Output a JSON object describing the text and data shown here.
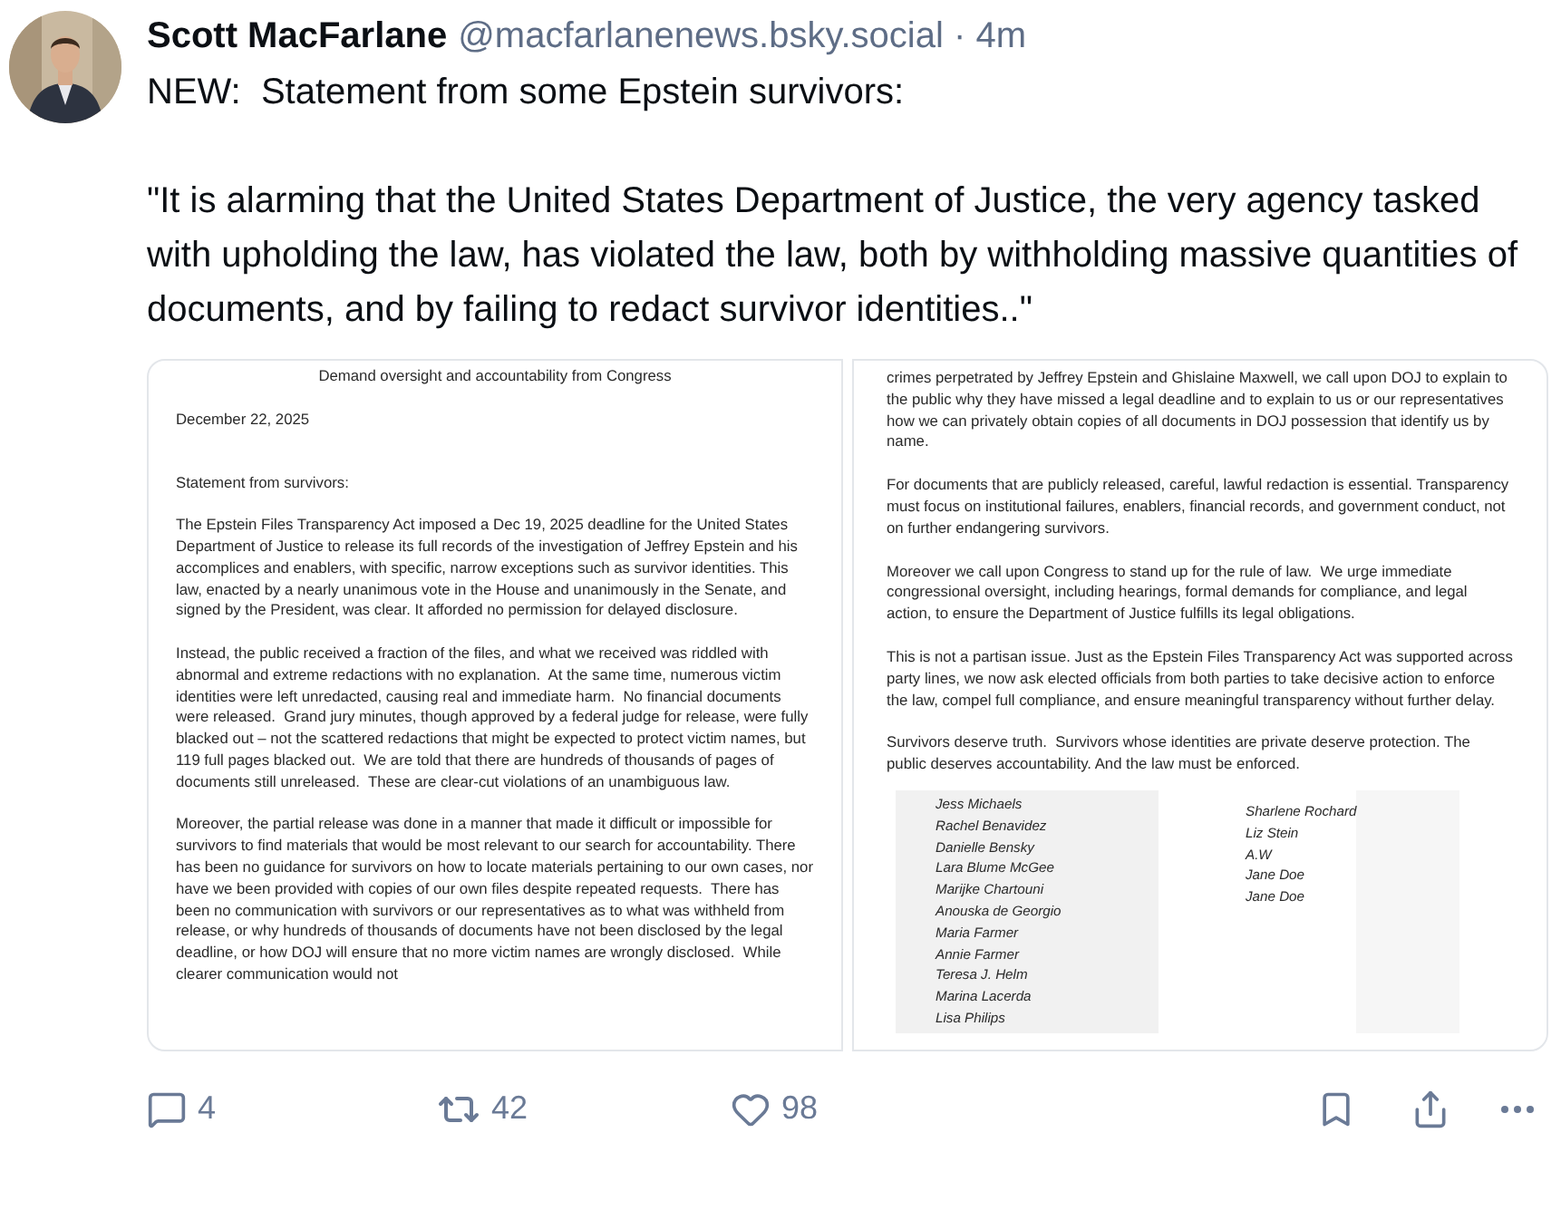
{
  "post": {
    "author": "Scott MacFarlane",
    "meta": "@macfarlanenews.bsky.social · 4m",
    "paragraphs": [
      "NEW:  Statement from some Epstein survivors:",
      "\"It is alarming that the United States Department of Justice, the very agency tasked with upholding the law, has violated the law, both by withholding massive quantities of documents, and by failing to redact survivor identities..\""
    ]
  },
  "attachments": [
    {
      "title": "Demand oversight and accountability from Congress",
      "date": "December 22, 2025",
      "paragraphs": [
        "Statement from survivors:",
        "The Epstein Files Transparency Act imposed a Dec 19, 2025 deadline for the United States Department of Justice to release its full records of the investigation of Jeffrey Epstein and his accomplices and enablers, with specific, narrow exceptions such as survivor identities. This law, enacted by a nearly unanimous vote in the House and unanimously in the Senate, and signed by the President, was clear. It afforded no permission for delayed disclosure.",
        "Instead, the public received a fraction of the files, and what we received was riddled with abnormal and extreme redactions with no explanation.  At the same time, numerous victim identities were left unredacted, causing real and immediate harm.  No financial documents were released.  Grand jury minutes, though approved by a federal judge for release, were fully blacked out – not the scattered redactions that might be expected to protect victim names, but 119 full pages blacked out.  We are told that there are hundreds of thousands of pages of documents still unreleased.  These are clear-cut violations of an unambiguous law.",
        "Moreover, the partial release was done in a manner that made it difficult or impossible for survivors to find materials that would be most relevant to our search for accountability. There has been no guidance for survivors on how to locate materials pertaining to our own cases, nor have we been provided with copies of our own files despite repeated requests.  There has been no communication with survivors or our representatives as to what was withheld from release, or why hundreds of thousands of documents have not been disclosed by the legal deadline, or how DOJ will ensure that no more victim names are wrongly disclosed.  While clearer communication would not"
      ]
    },
    {
      "paragraphs": [
        "crimes perpetrated by Jeffrey Epstein and Ghislaine Maxwell, we call upon DOJ to explain to the public why they have missed a legal deadline and to explain to us or our representatives how we can privately obtain copies of all documents in DOJ possession that identify us by name.",
        "For documents that are publicly released, careful, lawful redaction is essential. Transparency must focus on institutional failures, enablers, financial records, and government conduct, not on further endangering survivors.",
        "Moreover we call upon Congress to stand up for the rule of law.  We urge immediate congressional oversight, including hearings, formal demands for compliance, and legal action, to ensure the Department of Justice fulfills its legal obligations.",
        "This is not a partisan issue. Just as the Epstein Files Transparency Act was supported across party lines, we now ask elected officials from both parties to take decisive action to enforce the law, compel full compliance, and ensure meaningful transparency without further delay.",
        "Survivors deserve truth.  Survivors whose identities are private deserve protection. The public deserves accountability. And the law must be enforced."
      ],
      "signatories": [
        [
          "Jess Michaels",
          "Rachel Benavidez",
          "Danielle Bensky",
          "Lara Blume McGee",
          "Marijke Chartouni",
          "Anouska de Georgio",
          "Maria Farmer",
          "Annie Farmer",
          "Teresa J. Helm",
          "Marina Lacerda",
          "Lisa Philips"
        ],
        [
          "Sharlene Rochard",
          "Liz Stein",
          "A.W",
          "Jane Doe",
          "Jane Doe"
        ]
      ]
    }
  ],
  "actions": {
    "replies": "4",
    "reposts": "42",
    "likes": "98"
  }
}
